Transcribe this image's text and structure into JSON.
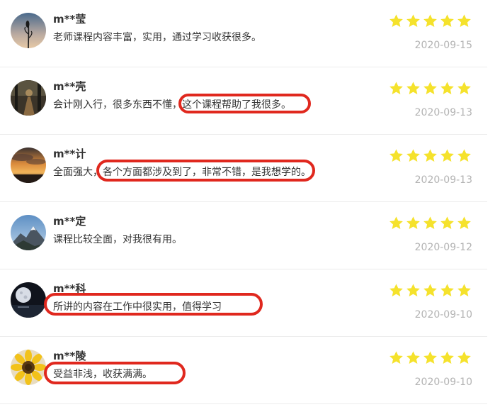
{
  "reviews": [
    {
      "user": "m**莹",
      "comment": "老师课程内容丰富，实用，通过学习收获很多。",
      "date": "2020-09-15",
      "rating": 5,
      "avatar": "night-sky-plant"
    },
    {
      "user": "m**壳",
      "comment": "会计刚入行，很多东西不懂，这个课程帮助了我很多。",
      "date": "2020-09-13",
      "rating": 5,
      "avatar": "forest-path"
    },
    {
      "user": "m**计",
      "comment": "全面强大，各个方面都涉及到了，非常不错，是我想学的。",
      "date": "2020-09-13",
      "rating": 5,
      "avatar": "sunset-clouds"
    },
    {
      "user": "m**定",
      "comment": "课程比较全面，对我很有用。",
      "date": "2020-09-12",
      "rating": 5,
      "avatar": "mountain-peak"
    },
    {
      "user": "m**科",
      "comment": "所讲的内容在工作中很实用，值得学习",
      "date": "2020-09-10",
      "rating": 5,
      "avatar": "moon-lake"
    },
    {
      "user": "m**陵",
      "comment": "受益非浅，收获满满。",
      "date": "2020-09-10",
      "rating": 5,
      "avatar": "sunflower"
    }
  ],
  "colors": {
    "star": "#f5e22c",
    "highlight": "#e0281e",
    "date": "#b3b3b3",
    "text": "#333333"
  }
}
